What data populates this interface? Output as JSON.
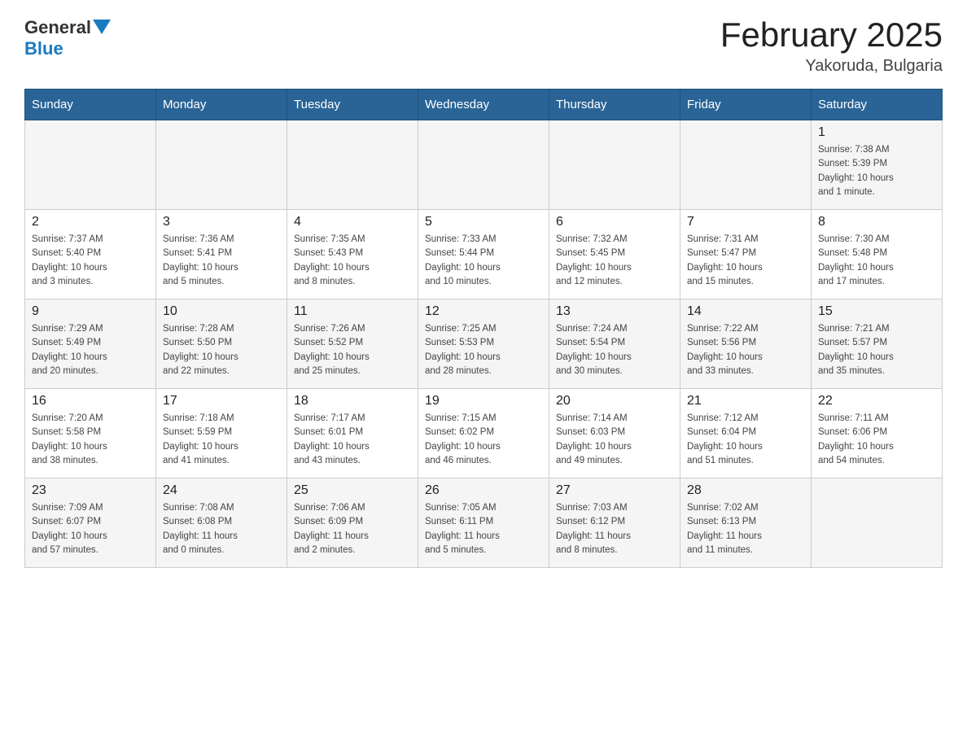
{
  "header": {
    "logo_general": "General",
    "logo_blue": "Blue",
    "month_title": "February 2025",
    "location": "Yakoruda, Bulgaria"
  },
  "days_of_week": [
    "Sunday",
    "Monday",
    "Tuesday",
    "Wednesday",
    "Thursday",
    "Friday",
    "Saturday"
  ],
  "weeks": [
    {
      "days": [
        {
          "num": "",
          "info": ""
        },
        {
          "num": "",
          "info": ""
        },
        {
          "num": "",
          "info": ""
        },
        {
          "num": "",
          "info": ""
        },
        {
          "num": "",
          "info": ""
        },
        {
          "num": "",
          "info": ""
        },
        {
          "num": "1",
          "info": "Sunrise: 7:38 AM\nSunset: 5:39 PM\nDaylight: 10 hours\nand 1 minute."
        }
      ]
    },
    {
      "days": [
        {
          "num": "2",
          "info": "Sunrise: 7:37 AM\nSunset: 5:40 PM\nDaylight: 10 hours\nand 3 minutes."
        },
        {
          "num": "3",
          "info": "Sunrise: 7:36 AM\nSunset: 5:41 PM\nDaylight: 10 hours\nand 5 minutes."
        },
        {
          "num": "4",
          "info": "Sunrise: 7:35 AM\nSunset: 5:43 PM\nDaylight: 10 hours\nand 8 minutes."
        },
        {
          "num": "5",
          "info": "Sunrise: 7:33 AM\nSunset: 5:44 PM\nDaylight: 10 hours\nand 10 minutes."
        },
        {
          "num": "6",
          "info": "Sunrise: 7:32 AM\nSunset: 5:45 PM\nDaylight: 10 hours\nand 12 minutes."
        },
        {
          "num": "7",
          "info": "Sunrise: 7:31 AM\nSunset: 5:47 PM\nDaylight: 10 hours\nand 15 minutes."
        },
        {
          "num": "8",
          "info": "Sunrise: 7:30 AM\nSunset: 5:48 PM\nDaylight: 10 hours\nand 17 minutes."
        }
      ]
    },
    {
      "days": [
        {
          "num": "9",
          "info": "Sunrise: 7:29 AM\nSunset: 5:49 PM\nDaylight: 10 hours\nand 20 minutes."
        },
        {
          "num": "10",
          "info": "Sunrise: 7:28 AM\nSunset: 5:50 PM\nDaylight: 10 hours\nand 22 minutes."
        },
        {
          "num": "11",
          "info": "Sunrise: 7:26 AM\nSunset: 5:52 PM\nDaylight: 10 hours\nand 25 minutes."
        },
        {
          "num": "12",
          "info": "Sunrise: 7:25 AM\nSunset: 5:53 PM\nDaylight: 10 hours\nand 28 minutes."
        },
        {
          "num": "13",
          "info": "Sunrise: 7:24 AM\nSunset: 5:54 PM\nDaylight: 10 hours\nand 30 minutes."
        },
        {
          "num": "14",
          "info": "Sunrise: 7:22 AM\nSunset: 5:56 PM\nDaylight: 10 hours\nand 33 minutes."
        },
        {
          "num": "15",
          "info": "Sunrise: 7:21 AM\nSunset: 5:57 PM\nDaylight: 10 hours\nand 35 minutes."
        }
      ]
    },
    {
      "days": [
        {
          "num": "16",
          "info": "Sunrise: 7:20 AM\nSunset: 5:58 PM\nDaylight: 10 hours\nand 38 minutes."
        },
        {
          "num": "17",
          "info": "Sunrise: 7:18 AM\nSunset: 5:59 PM\nDaylight: 10 hours\nand 41 minutes."
        },
        {
          "num": "18",
          "info": "Sunrise: 7:17 AM\nSunset: 6:01 PM\nDaylight: 10 hours\nand 43 minutes."
        },
        {
          "num": "19",
          "info": "Sunrise: 7:15 AM\nSunset: 6:02 PM\nDaylight: 10 hours\nand 46 minutes."
        },
        {
          "num": "20",
          "info": "Sunrise: 7:14 AM\nSunset: 6:03 PM\nDaylight: 10 hours\nand 49 minutes."
        },
        {
          "num": "21",
          "info": "Sunrise: 7:12 AM\nSunset: 6:04 PM\nDaylight: 10 hours\nand 51 minutes."
        },
        {
          "num": "22",
          "info": "Sunrise: 7:11 AM\nSunset: 6:06 PM\nDaylight: 10 hours\nand 54 minutes."
        }
      ]
    },
    {
      "days": [
        {
          "num": "23",
          "info": "Sunrise: 7:09 AM\nSunset: 6:07 PM\nDaylight: 10 hours\nand 57 minutes."
        },
        {
          "num": "24",
          "info": "Sunrise: 7:08 AM\nSunset: 6:08 PM\nDaylight: 11 hours\nand 0 minutes."
        },
        {
          "num": "25",
          "info": "Sunrise: 7:06 AM\nSunset: 6:09 PM\nDaylight: 11 hours\nand 2 minutes."
        },
        {
          "num": "26",
          "info": "Sunrise: 7:05 AM\nSunset: 6:11 PM\nDaylight: 11 hours\nand 5 minutes."
        },
        {
          "num": "27",
          "info": "Sunrise: 7:03 AM\nSunset: 6:12 PM\nDaylight: 11 hours\nand 8 minutes."
        },
        {
          "num": "28",
          "info": "Sunrise: 7:02 AM\nSunset: 6:13 PM\nDaylight: 11 hours\nand 11 minutes."
        },
        {
          "num": "",
          "info": ""
        }
      ]
    }
  ]
}
